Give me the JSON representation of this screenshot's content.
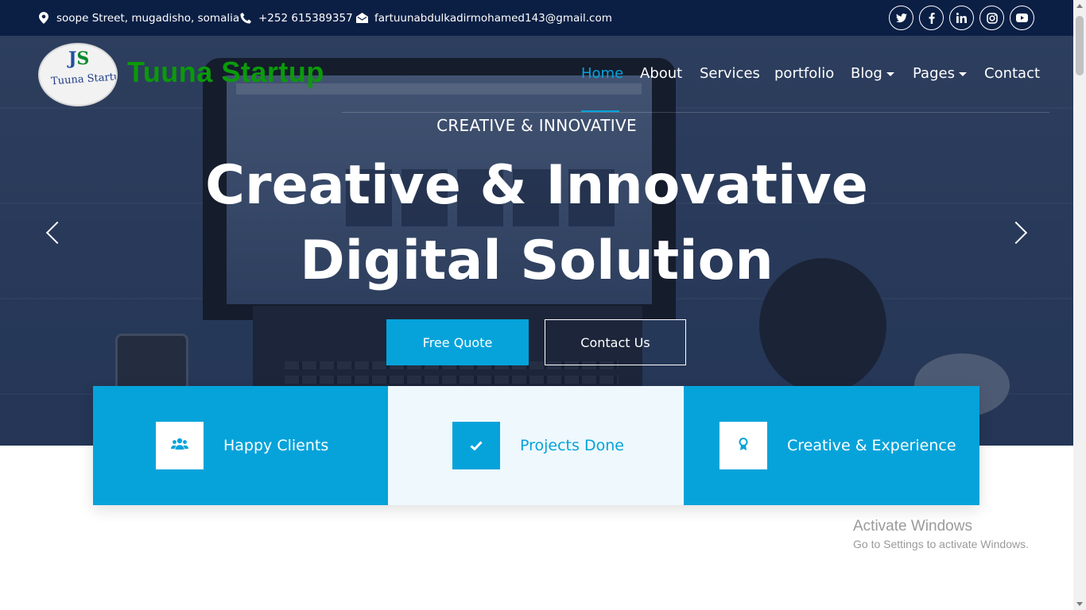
{
  "topbar": {
    "address": "soope Street, mugadisho, somalia",
    "phone": "+252 615389357",
    "email": "fartuunabdulkadirmohamed143@gmail.com",
    "socials": [
      {
        "icon": "twitter-icon",
        "glyph": "t"
      },
      {
        "icon": "facebook-icon",
        "glyph": "f"
      },
      {
        "icon": "linkedin-icon",
        "glyph": "in"
      },
      {
        "icon": "instagram-icon",
        "glyph": "◎"
      },
      {
        "icon": "youtube-icon",
        "glyph": "▶"
      }
    ]
  },
  "brand": {
    "logo_text": "Tuuna Startup",
    "name": "Tuuna Startup"
  },
  "nav": {
    "items": [
      "Home",
      "About",
      "Services",
      "portfolio",
      "Blog",
      "Pages",
      "Contact"
    ],
    "active": "Home"
  },
  "hero": {
    "subtitle": "CREATIVE & INNOVATIVE",
    "title_line1": "Creative & Innovative",
    "title_line2": "Digital Solution",
    "btn_primary": "Free Quote",
    "btn_secondary": "Contact Us"
  },
  "features": [
    {
      "label": "Happy Clients",
      "icon": "users-icon"
    },
    {
      "label": "Projects Done",
      "icon": "check-icon"
    },
    {
      "label": "Creative & Experience",
      "icon": "award-icon"
    }
  ],
  "watermark": {
    "line1": "Activate Windows",
    "line2": "Go to Settings to activate Windows."
  },
  "colors": {
    "accent": "#06a3da",
    "topbar": "#0b1f45",
    "brand_green": "#0a9a0a"
  }
}
